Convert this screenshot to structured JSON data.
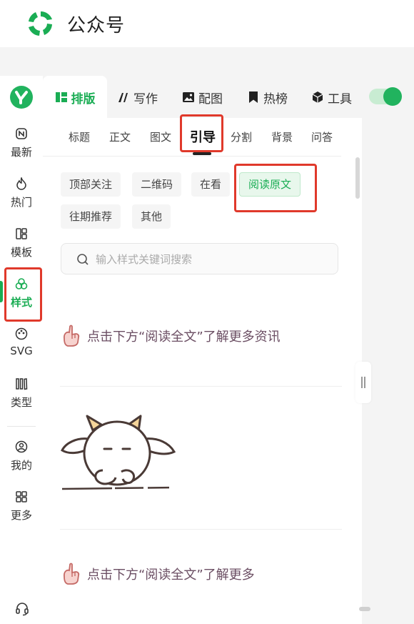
{
  "header": {
    "title": "公众号"
  },
  "rail": {
    "items": [
      {
        "label": "最新",
        "icon": "new-icon"
      },
      {
        "label": "热门",
        "icon": "fire-icon"
      },
      {
        "label": "模板",
        "icon": "template-icon"
      },
      {
        "label": "样式",
        "icon": "style-icon"
      },
      {
        "label": "SVG",
        "icon": "svg-icon"
      },
      {
        "label": "类型",
        "icon": "category-icon"
      },
      {
        "label": "我的",
        "icon": "user-icon"
      },
      {
        "label": "更多",
        "icon": "grid-icon"
      }
    ],
    "active": "样式"
  },
  "main_tabs": [
    {
      "label": "排版",
      "icon": "layout-icon"
    },
    {
      "label": "写作",
      "icon": "pen-icon"
    },
    {
      "label": "配图",
      "icon": "image-icon"
    },
    {
      "label": "热榜",
      "icon": "bookmark-icon"
    },
    {
      "label": "工具",
      "icon": "cube-icon"
    }
  ],
  "sub_tabs": [
    "标题",
    "正文",
    "图文",
    "引导",
    "分割",
    "背景",
    "问答"
  ],
  "active_sub_tab": "引导",
  "chips": [
    "顶部关注",
    "二维码",
    "在看",
    "阅读原文",
    "往期推荐",
    "其他"
  ],
  "active_chip": "阅读原文",
  "search": {
    "placeholder": "输入样式关键词搜索"
  },
  "style_items": [
    {
      "text": "点击下方“阅读全文”了解更多资讯"
    },
    {
      "text": "点击下方“阅读全文”了解更多"
    }
  ],
  "colors": {
    "accent": "#1aad54",
    "highlight_box": "#e0392b",
    "style_text": "#6b4e63"
  }
}
